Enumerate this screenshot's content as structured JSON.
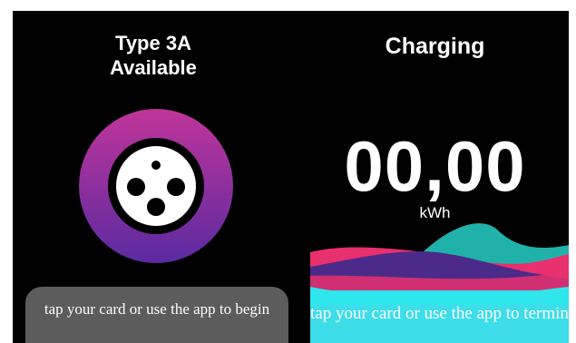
{
  "left_panel": {
    "connector_title_line1": "Type 3A",
    "connector_title_line2": "Available",
    "connector_icon": "type-3a-socket-icon",
    "tap_prompt": "tap your card or use the app to begin"
  },
  "right_panel": {
    "status_title": "Charging",
    "energy_value": "00,00",
    "energy_unit": "kWh",
    "terminate_prompt": "tap your card or use the app to terminate"
  },
  "colors": {
    "background": "#000000",
    "ring_top": "#c0359a",
    "ring_bottom": "#5a2aa0",
    "wave_teal": "#20b2aa",
    "wave_pink": "#e8306e",
    "wave_purple": "#4b2a8a",
    "wave_cyan": "#2fe6ec",
    "tap_panel": "#5c5c5c"
  }
}
